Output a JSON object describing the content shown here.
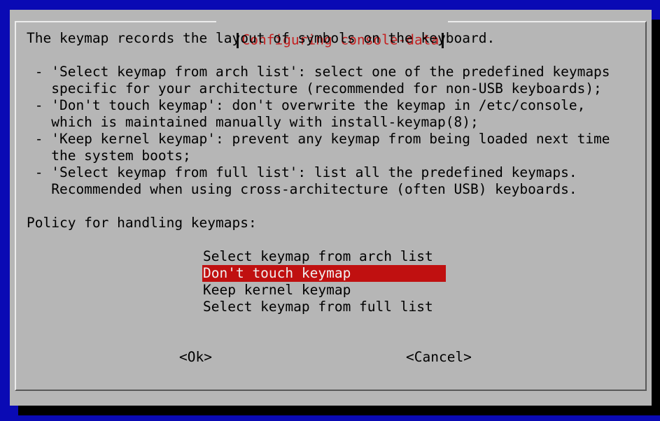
{
  "dialog": {
    "title": "Configuring console-data",
    "description_lines": [
      "The keymap records the layout of symbols on the keyboard.",
      " - 'Select keymap from arch list': select one of the predefined keymaps",
      "   specific for your architecture (recommended for non-USB keyboards);",
      " - 'Don't touch keymap': don't overwrite the keymap in /etc/console,",
      "   which is maintained manually with install-keymap(8);",
      " - 'Keep kernel keymap': prevent any keymap from being loaded next time",
      "   the system boots;",
      " - 'Select keymap from full list': list all the predefined keymaps.",
      "   Recommended when using cross-architecture (often USB) keyboards."
    ],
    "prompt": "Policy for handling keymaps:",
    "options": [
      "Select keymap from arch list",
      "Don't touch keymap",
      "Keep kernel keymap",
      "Select keymap from full list"
    ],
    "selected_option": "Don't touch keymap",
    "ok_label": "<Ok>",
    "cancel_label": "<Cancel>"
  },
  "colors": {
    "screen_background": "#0a0ab4",
    "dialog_background": "#b6b6b6",
    "title_text": "#c41e1e",
    "selection_background": "#c01010",
    "selection_text": "#f0f0f0"
  }
}
